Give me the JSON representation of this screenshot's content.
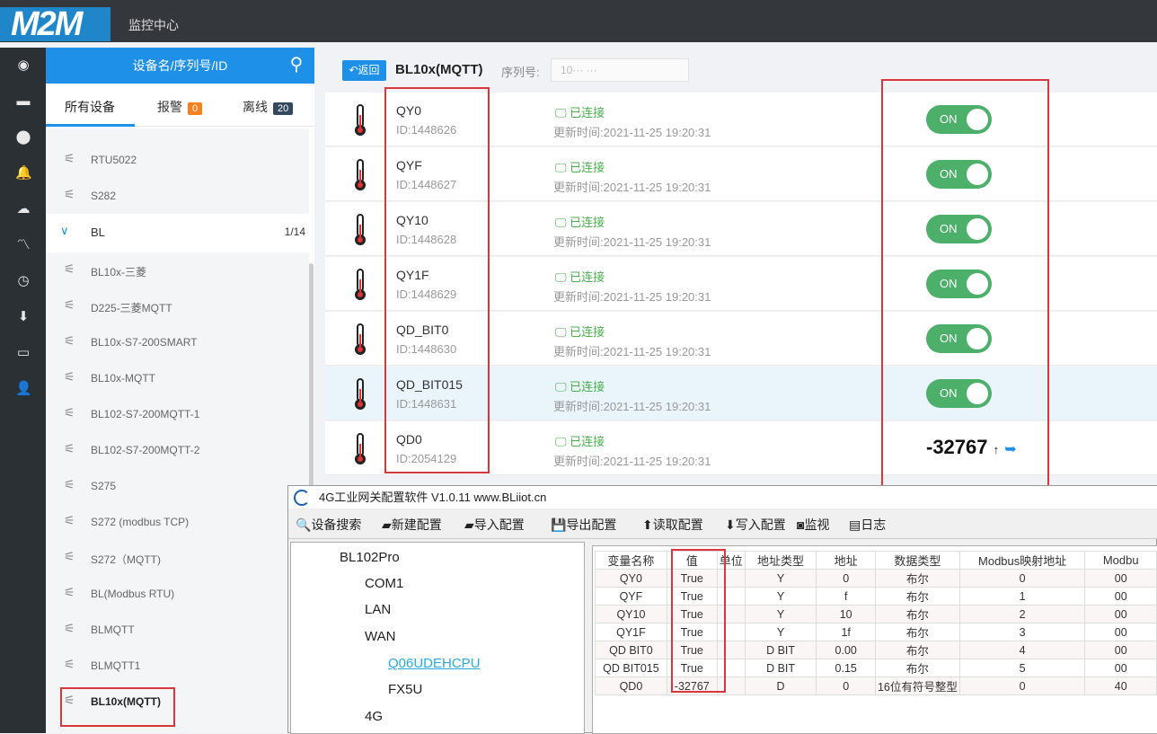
{
  "topbar": {
    "logo": "M2M",
    "title": "监控中心"
  },
  "rail": [
    "target-icon",
    "monitor-icon",
    "location-icon",
    "bell-icon",
    "cloud-icon",
    "chart-icon",
    "clock-icon",
    "download-icon",
    "card-icon",
    "user-icon"
  ],
  "sidebar": {
    "search_placeholder": "设备名/序列号/ID",
    "tabs": [
      {
        "label": "所有设备"
      },
      {
        "label": "报警",
        "count": "0",
        "color": "#f5821f"
      },
      {
        "label": "离线",
        "count": "20",
        "color": "#34495e"
      }
    ],
    "items": [
      {
        "label": "RTU5022"
      },
      {
        "label": "S282"
      }
    ],
    "group": {
      "label": "BL",
      "count": "1/14"
    },
    "group_items": [
      {
        "label": "BL10x-三菱"
      },
      {
        "label": "D225-三菱MQTT"
      },
      {
        "label": "BL10x-S7-200SMART"
      },
      {
        "label": "BL10x-MQTT"
      },
      {
        "label": "BL102-S7-200MQTT-1"
      },
      {
        "label": "BL102-S7-200MQTT-2"
      },
      {
        "label": "S275"
      },
      {
        "label": "S272 (modbus TCP)"
      },
      {
        "label": "S272（MQTT)"
      },
      {
        "label": "BL(Modbus RTU)"
      },
      {
        "label": "BLMQTT"
      },
      {
        "label": "BLMQTT1"
      },
      {
        "label": "BL10x(MQTT)"
      }
    ]
  },
  "detail": {
    "back": "返回",
    "title": "BL10x(MQTT)",
    "serial_label": "序列号:",
    "serial_value": "10··· ···",
    "accent": "#1e90e8",
    "rows": [
      {
        "name": "QY0",
        "id": "ID:1448626",
        "status": "已连接",
        "updated": "更新时间:2021-11-25 19:20:31",
        "value": "ON"
      },
      {
        "name": "QYF",
        "id": "ID:1448627",
        "status": "已连接",
        "updated": "更新时间:2021-11-25 19:20:31",
        "value": "ON"
      },
      {
        "name": "QY10",
        "id": "ID:1448628",
        "status": "已连接",
        "updated": "更新时间:2021-11-25 19:20:31",
        "value": "ON"
      },
      {
        "name": "QY1F",
        "id": "ID:1448629",
        "status": "已连接",
        "updated": "更新时间:2021-11-25 19:20:31",
        "value": "ON"
      },
      {
        "name": "QD_BIT0",
        "id": "ID:1448630",
        "status": "已连接",
        "updated": "更新时间:2021-11-25 19:20:31",
        "value": "ON"
      },
      {
        "name": "QD_BIT015",
        "id": "ID:1448631",
        "status": "已连接",
        "updated": "更新时间:2021-11-25 19:20:31",
        "value": "ON"
      },
      {
        "name": "QD0",
        "id": "ID:2054129",
        "status": "已连接",
        "updated": "更新时间:2021-11-25 19:20:31",
        "value": "-32767"
      }
    ]
  },
  "config": {
    "title": "4G工业网关配置软件 V1.0.11 www.BLiiot.cn",
    "toolbar": [
      "设备搜索",
      "新建配置",
      "导入配置",
      "导出配置",
      "读取配置",
      "写入配置",
      "监视",
      "日志"
    ],
    "tree": [
      "BL102Pro",
      "COM1",
      "LAN",
      "WAN",
      "Q06UDEHCPU",
      "FX5U",
      "4G"
    ],
    "columns": [
      "变量名称",
      "值",
      "单位",
      "地址类型",
      "地址",
      "数据类型",
      "Modbus映射地址",
      "Modbu"
    ],
    "rows": [
      [
        "QY0",
        "True",
        "",
        "Y",
        "0",
        "布尔",
        "0",
        "00"
      ],
      [
        "QYF",
        "True",
        "",
        "Y",
        "f",
        "布尔",
        "1",
        "00"
      ],
      [
        "QY10",
        "True",
        "",
        "Y",
        "10",
        "布尔",
        "2",
        "00"
      ],
      [
        "QY1F",
        "True",
        "",
        "Y",
        "1f",
        "布尔",
        "3",
        "00"
      ],
      [
        "QD BIT0",
        "True",
        "",
        "D BIT",
        "0.00",
        "布尔",
        "4",
        "00"
      ],
      [
        "QD BIT015",
        "True",
        "",
        "D BIT",
        "0.15",
        "布尔",
        "5",
        "00"
      ],
      [
        "QD0",
        "-32767",
        "",
        "D",
        "0",
        "16位有符号整型",
        "0",
        "40"
      ]
    ]
  }
}
